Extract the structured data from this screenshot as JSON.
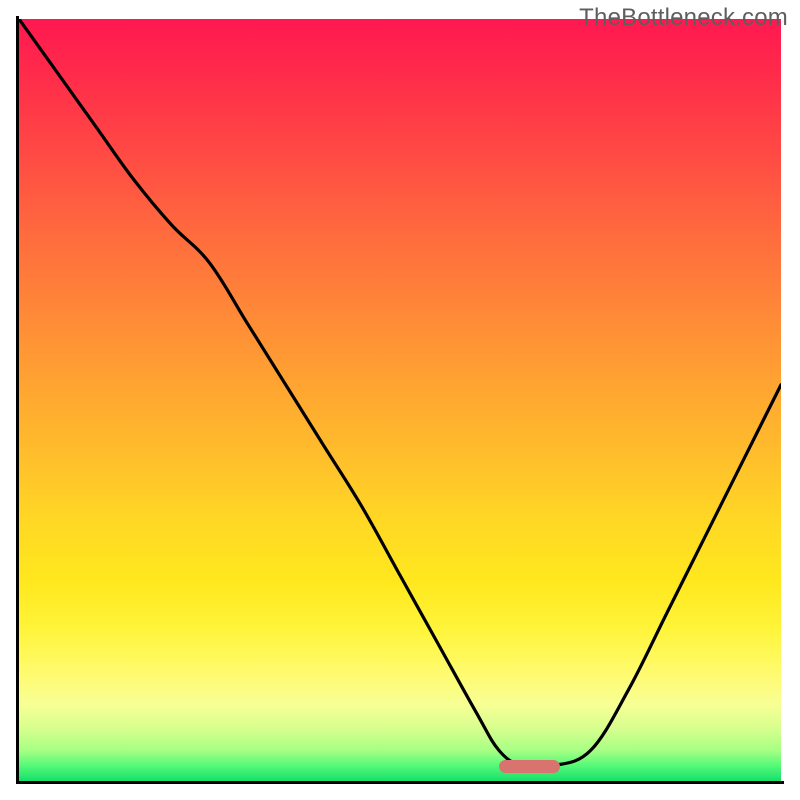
{
  "watermark": "TheBottleneck.com",
  "colors": {
    "gradient_top": "#ff1850",
    "gradient_bottom": "#14e06a",
    "curve": "#000000",
    "axis": "#000000",
    "marker": "#d8736f"
  },
  "chart_data": {
    "type": "line",
    "title": "",
    "xlabel": "",
    "ylabel": "",
    "xlim": [
      0,
      100
    ],
    "ylim": [
      0,
      100
    ],
    "x": [
      0,
      5,
      10,
      15,
      20,
      25,
      30,
      35,
      40,
      45,
      50,
      55,
      60,
      63,
      66,
      70,
      75,
      80,
      85,
      90,
      95,
      100
    ],
    "values": [
      100,
      93,
      86,
      79,
      73,
      68,
      60,
      52,
      44,
      36,
      27,
      18,
      9,
      4,
      2,
      2,
      4,
      12,
      22,
      32,
      42,
      52
    ],
    "marker": {
      "x_start": 63,
      "x_end": 71,
      "y": 2
    },
    "note": "Values read from curve position relative to plot height; 0 = bottom axis, 100 = top."
  }
}
